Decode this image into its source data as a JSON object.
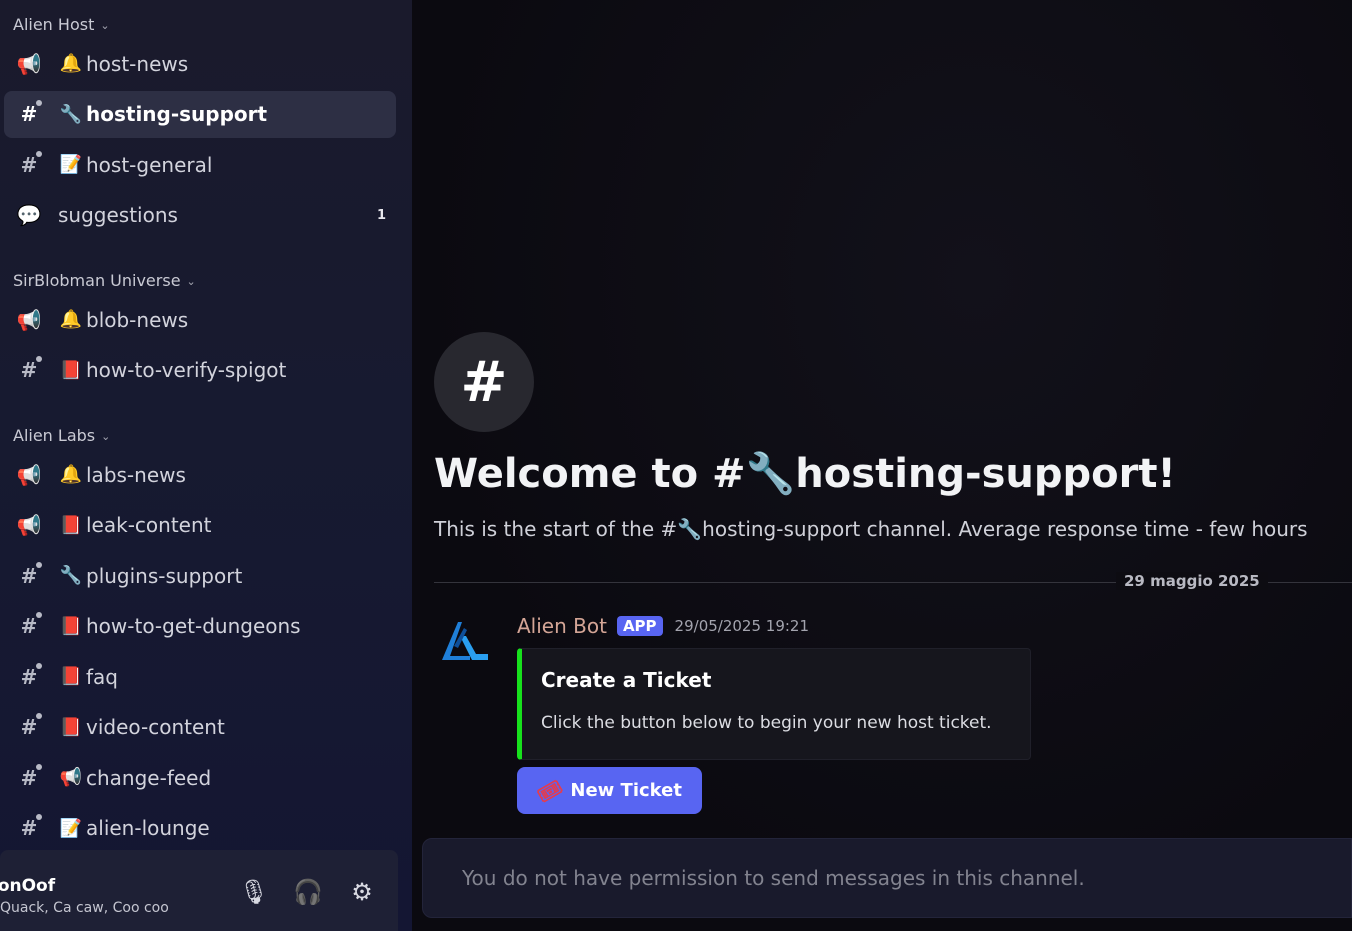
{
  "sidebar": {
    "categories": [
      {
        "name": "Alien Host",
        "channels": [
          {
            "type": "announcement",
            "emoji": "🔔",
            "name": "host-news"
          },
          {
            "type": "text",
            "emoji": "🔧",
            "name": "hosting-support",
            "active": true
          },
          {
            "type": "text",
            "emoji": "📝",
            "name": "host-general"
          },
          {
            "type": "forum",
            "emoji": "",
            "name": "suggestions",
            "badge": "1"
          }
        ]
      },
      {
        "name": "SirBlobman Universe",
        "channels": [
          {
            "type": "announcement",
            "emoji": "🔔",
            "name": "blob-news"
          },
          {
            "type": "text",
            "emoji": "📕",
            "name": "how-to-verify-spigot"
          }
        ]
      },
      {
        "name": "Alien Labs",
        "channels": [
          {
            "type": "announcement",
            "emoji": "🔔",
            "name": "labs-news"
          },
          {
            "type": "announcement",
            "emoji": "📕",
            "name": "leak-content"
          },
          {
            "type": "text",
            "emoji": "🔧",
            "name": "plugins-support"
          },
          {
            "type": "text",
            "emoji": "📕",
            "name": "how-to-get-dungeons"
          },
          {
            "type": "text",
            "emoji": "📕",
            "name": "faq"
          },
          {
            "type": "text",
            "emoji": "📕",
            "name": "video-content"
          },
          {
            "type": "text",
            "emoji": "📢",
            "name": "change-feed"
          },
          {
            "type": "text",
            "emoji": "📝",
            "name": "alien-lounge"
          }
        ]
      }
    ],
    "user": {
      "name": "lonOof",
      "status": "Quack, Ca caw, Coo coo",
      "controls": [
        "microphone-icon",
        "headphones-icon",
        "settings-gear-icon"
      ]
    }
  },
  "main": {
    "channel_hash": "#",
    "welcome": "Welcome to #🔧hosting-support!",
    "intro": "This is the start of the #🔧hosting-support channel. Average response time - few hours",
    "date_divider": "29 maggio 2025",
    "message": {
      "author": "Alien Bot",
      "tag": "APP",
      "timestamp": "29/05/2025 19:21",
      "embed": {
        "title": "Create a Ticket",
        "description": "Click the button below to begin your new host ticket.",
        "accent_color": "#17e11c"
      },
      "button_label": "New Ticket",
      "button_icon": "ticket-icon"
    },
    "composer_text": "You do not have permission to send messages in this channel."
  },
  "colors": {
    "brand": "#5865f2",
    "embed_accent": "#17e11c",
    "bot_name": "#d4a596"
  }
}
